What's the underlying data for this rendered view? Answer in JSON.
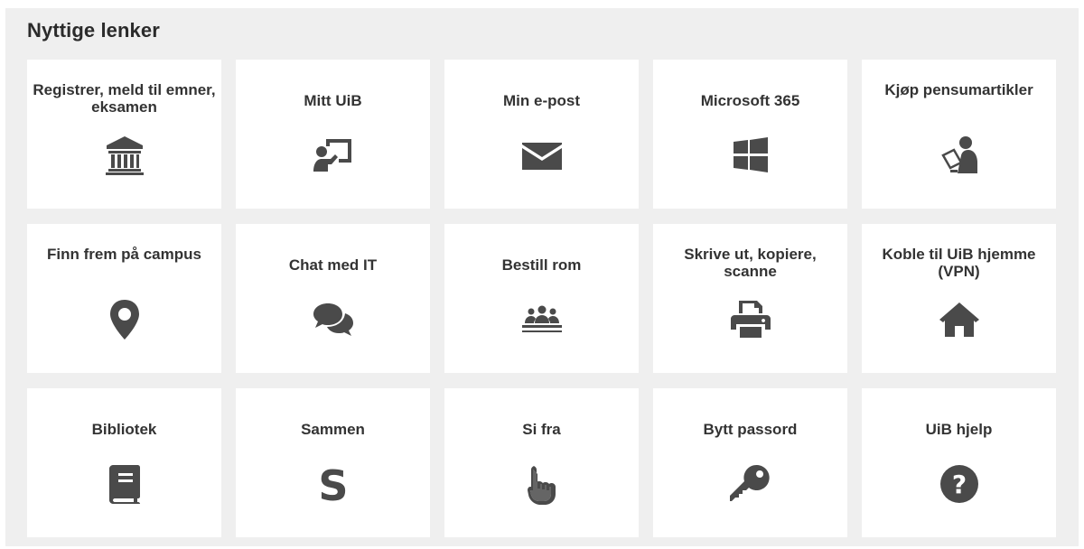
{
  "section": {
    "title": "Nyttige lenker"
  },
  "tiles": [
    {
      "label": "Registrer, meld til emner, eksamen",
      "icon": "university-icon"
    },
    {
      "label": "Mitt UiB",
      "icon": "teacher-board-icon"
    },
    {
      "label": "Min e-post",
      "icon": "envelope-icon"
    },
    {
      "label": "Microsoft 365",
      "icon": "windows-icon"
    },
    {
      "label": "Kjøp pensumartikler",
      "icon": "reader-tablet-icon"
    },
    {
      "label": "Finn frem på campus",
      "icon": "map-marker-icon"
    },
    {
      "label": "Chat med IT",
      "icon": "chat-bubbles-icon"
    },
    {
      "label": "Bestill rom",
      "icon": "group-table-icon"
    },
    {
      "label": "Skrive ut, kopiere, scanne",
      "icon": "printer-icon"
    },
    {
      "label": "Koble til UiB hjemme (VPN)",
      "icon": "home-icon"
    },
    {
      "label": "Bibliotek",
      "icon": "book-icon"
    },
    {
      "label": "Sammen",
      "icon": "sammen-s-icon"
    },
    {
      "label": "Si fra",
      "icon": "hand-pointer-icon"
    },
    {
      "label": "Bytt passord",
      "icon": "key-icon"
    },
    {
      "label": "UiB hjelp",
      "icon": "question-circle-icon"
    }
  ],
  "colors": {
    "panel_background": "#efefef",
    "tile_background": "#ffffff",
    "icon": "#4a4a4a",
    "text": "#333333"
  }
}
